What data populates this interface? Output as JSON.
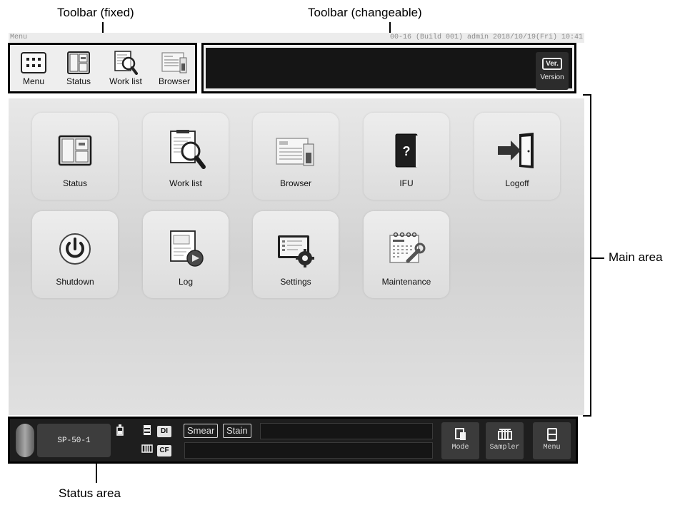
{
  "annotations": {
    "toolbar_fixed": "Toolbar (fixed)",
    "toolbar_changeable": "Toolbar (changeable)",
    "main_area": "Main area",
    "status_area": "Status area"
  },
  "title_bar": {
    "screen_name": "Menu",
    "info": "00-16 (Build 001) admin 2018/10/19(Fri) 10:41"
  },
  "toolbar_fixed": {
    "buttons": [
      {
        "label": "Menu",
        "icon": "grid-icon"
      },
      {
        "label": "Status",
        "icon": "status-icon"
      },
      {
        "label": "Work list",
        "icon": "worklist-magnifier-icon"
      },
      {
        "label": "Browser",
        "icon": "browser-icon"
      }
    ]
  },
  "toolbar_changeable": {
    "version_badge": "Ver.",
    "version_label": "Version"
  },
  "main_menu": {
    "tiles": [
      {
        "label": "Status",
        "icon": "status-icon"
      },
      {
        "label": "Work list",
        "icon": "worklist-magnifier-icon"
      },
      {
        "label": "Browser",
        "icon": "browser-icon"
      },
      {
        "label": "IFU",
        "icon": "book-question-icon",
        "glyph": "?"
      },
      {
        "label": "Logoff",
        "icon": "door-arrow-icon"
      },
      {
        "label": "Shutdown",
        "icon": "power-icon"
      },
      {
        "label": "Log",
        "icon": "log-icon"
      },
      {
        "label": "Settings",
        "icon": "settings-gear-icon"
      },
      {
        "label": "Maintenance",
        "icon": "calendar-wrench-icon"
      }
    ]
  },
  "status_area": {
    "instrument": "SP-50-1",
    "di_chip": "DI",
    "cf_chip": "CF",
    "smear_label": "Smear",
    "stain_label": "Stain",
    "buttons": [
      {
        "label": "Mode",
        "icon": "mode-icon"
      },
      {
        "label": "Sampler",
        "icon": "sampler-rack-icon"
      },
      {
        "label": "Menu",
        "icon": "menu-panel-icon"
      }
    ]
  },
  "colors": {
    "toolbar_bg": "#eeeeee",
    "dark_bar": "#151515",
    "status_bg": "#1e1e1e"
  }
}
